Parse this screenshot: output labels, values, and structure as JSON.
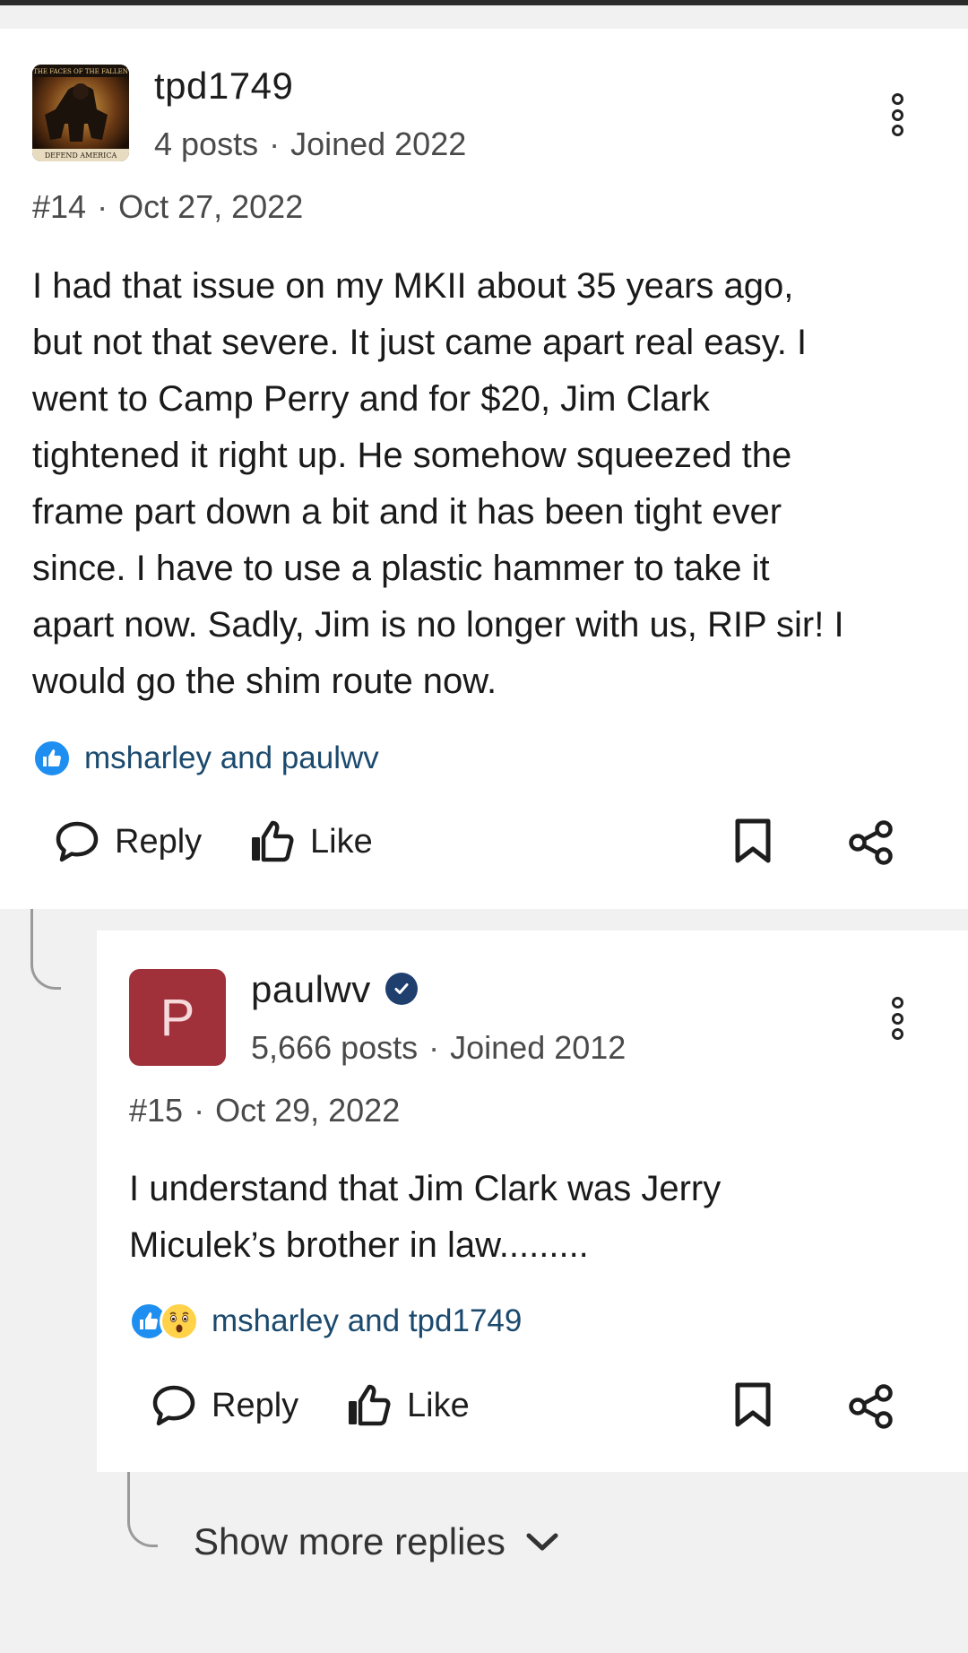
{
  "posts": [
    {
      "username": "tpd1749",
      "avatar_caption_top": "THE FACES OF THE FALLEN",
      "avatar_caption_bottom": "DEFEND AMERICA",
      "posts_count": "4 posts",
      "joined": "Joined 2022",
      "number": "#14",
      "date": "Oct 27, 2022",
      "body_lines": [
        "I had that issue on my MKII about 35 years ago,",
        "but not that severe. It just came apart real easy. I",
        "went to Camp Perry and for $20, Jim Clark",
        "tightened it right up. He somehow squeezed the",
        "frame part down a bit and it has been tight ever",
        "since. I have to use a plastic hammer to take it",
        "apart now. Sadly, Jim is no longer with us, RIP sir! I",
        "would go the shim route now."
      ],
      "reactors": "msharley and paulwv",
      "reply_label": "Reply",
      "like_label": "Like"
    },
    {
      "username": "paulwv",
      "avatar_letter": "P",
      "posts_count": "5,666 posts",
      "joined": "Joined 2012",
      "number": "#15",
      "date": "Oct 29, 2022",
      "body_lines": [
        "I understand that Jim Clark was Jerry",
        "Miculek’s brother in law........."
      ],
      "reactors": "msharley and tpd1749",
      "reply_label": "Reply",
      "like_label": "Like"
    }
  ],
  "show_more_label": "Show more replies",
  "icons": [
    "kebab-menu-icon",
    "verified-badge-icon",
    "thumbs-up-reaction-icon",
    "wow-reaction-icon",
    "speech-bubble-icon",
    "thumbs-up-icon",
    "bookmark-icon",
    "share-icon",
    "chevron-down-icon"
  ],
  "colors": {
    "accent_blue": "#1e8ff0",
    "reactor_link": "#1b4a6e",
    "avatar_red": "#a0313a",
    "verified_navy": "#1f3f6e"
  }
}
